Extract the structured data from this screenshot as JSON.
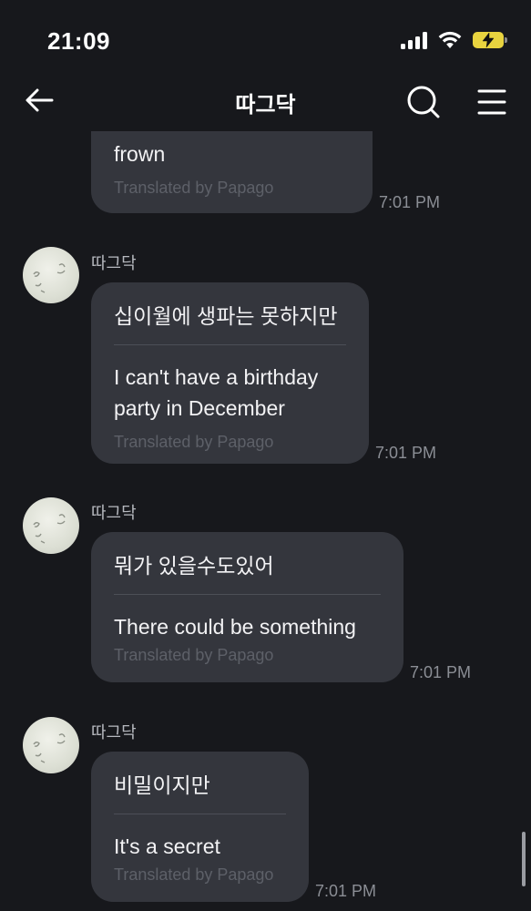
{
  "status_bar": {
    "time": "21:09"
  },
  "header": {
    "title": "따그닥"
  },
  "messages": [
    {
      "translation": "frown",
      "credit": "Translated by Papago",
      "time": "7:01 PM"
    },
    {
      "sender": "따그닥",
      "original": "십이월에 생파는 못하지만",
      "translation_line1": "I can't have a birthday",
      "translation_line2": "party in December",
      "credit": "Translated by Papago",
      "time": "7:01 PM"
    },
    {
      "sender": "따그닥",
      "original": "뭐가 있을수도있어",
      "translation": "There could be something",
      "credit": "Translated by Papago",
      "time": "7:01 PM"
    },
    {
      "sender": "따그닥",
      "original": "비밀이지만",
      "translation": "It's a secret",
      "credit": "Translated by Papago",
      "time": "7:01 PM"
    }
  ],
  "colors": {
    "background": "#17181c",
    "bubble": "#34363d",
    "battery": "#e8d33f"
  },
  "icons": [
    "back-arrow-icon",
    "search-icon",
    "menu-icon",
    "signal-icon",
    "wifi-icon",
    "battery-charging-icon"
  ]
}
